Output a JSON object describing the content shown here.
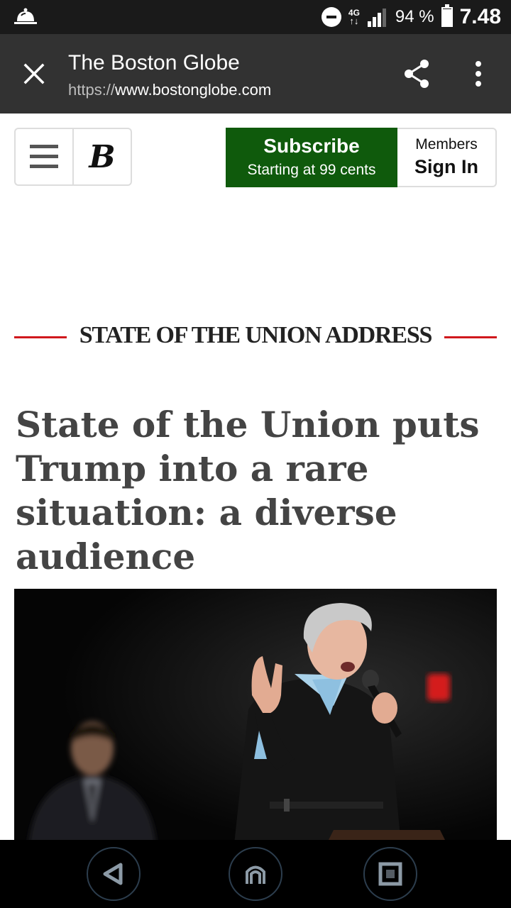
{
  "status_bar": {
    "network": "4G",
    "battery_percent": "94 %",
    "battery_level": 0.94,
    "time": "7.48",
    "icons": [
      "notification-bell-icon",
      "do-not-disturb-icon",
      "data-arrows-icon",
      "signal-icon",
      "battery-icon"
    ]
  },
  "browser": {
    "title": "The Boston Globe",
    "url_scheme": "https://",
    "url_host": "www.bostonglobe.com",
    "icons": [
      "close-icon",
      "share-icon",
      "more-options-icon"
    ]
  },
  "site_header": {
    "logo_letter": "B",
    "subscribe_label": "Subscribe",
    "subscribe_sub": "Starting at 99 cents",
    "members_label": "Members",
    "signin_label": "Sign In",
    "icons": [
      "menu-icon"
    ],
    "colors": {
      "subscribe_bg": "#0f5a0c",
      "kicker_rule": "#d0181d"
    }
  },
  "article": {
    "section": "STATE OF THE UNION ADDRESS",
    "headline": "State of the Union puts Trump into a rare situation: a diverse audience"
  },
  "nav_bar": {
    "icons": [
      "back-icon",
      "home-icon",
      "recents-icon"
    ]
  }
}
